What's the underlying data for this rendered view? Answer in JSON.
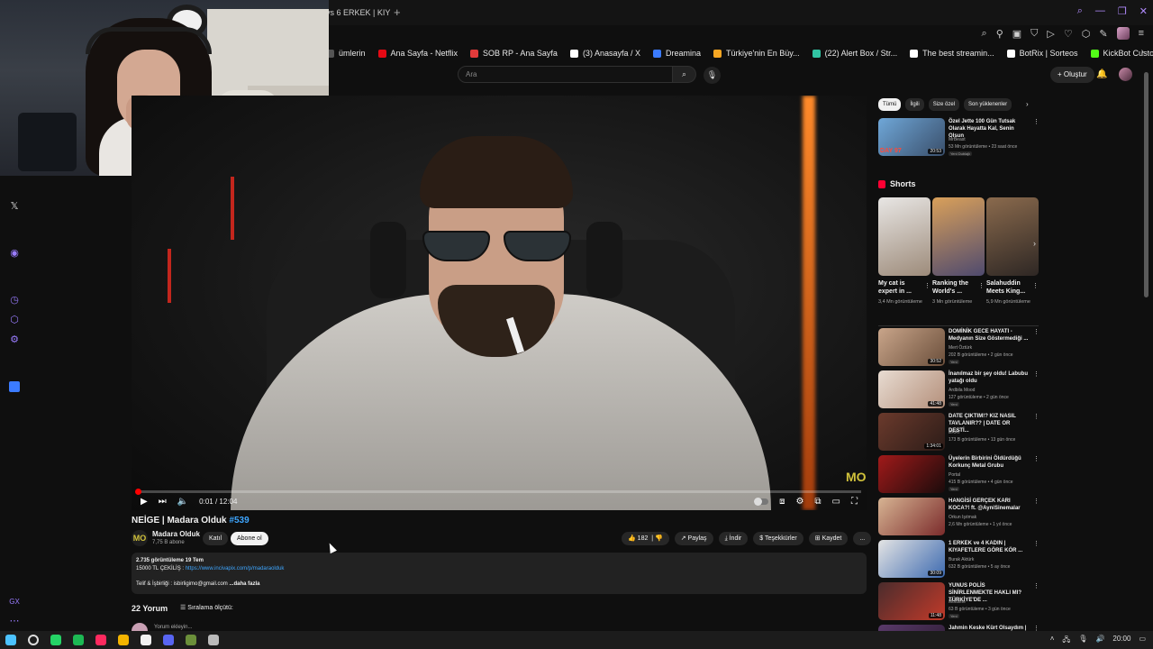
{
  "browser": {
    "tab_title": "ys 6 ERKEK | KIY",
    "tab_new": "+",
    "window_controls": [
      "search-icon",
      "minimize-icon",
      "restore-icon",
      "close-icon"
    ],
    "bookmarks": [
      {
        "label": "ümlerin",
        "color": "#555555"
      },
      {
        "label": "Ana Sayfa - Netflix",
        "color": "#e50914"
      },
      {
        "label": "SOB RP - Ana Sayfa",
        "color": "#e23b3b"
      },
      {
        "label": "(3) Anasayfa / X",
        "color": "#ffffff"
      },
      {
        "label": "Dreamina",
        "color": "#3b7bff"
      },
      {
        "label": "Türkiye'nin En Büy...",
        "color": "#f5a623"
      },
      {
        "label": "(22) Alert Box / Str...",
        "color": "#31c4a3"
      },
      {
        "label": "The best streamin...",
        "color": "#ffffff"
      },
      {
        "label": "BotRix | Sorteos",
        "color": "#ffffff"
      },
      {
        "label": "KickBot Custom C...",
        "color": "#53fc18"
      }
    ]
  },
  "youtube": {
    "search_placeholder": "Ara",
    "create_label": "+ Oluştur",
    "video": {
      "title": "NEİGE | Madara Olduk",
      "hashtag": "#539",
      "time": "0:01 / 12:04",
      "progress": 0.002,
      "watermark": "MO"
    },
    "channel": {
      "name": "Madara Olduk",
      "subs": "7,75 B abone",
      "avatar_text": "MO",
      "join_label": "Katıl",
      "subscribe_label": "Abone ol"
    },
    "actions": {
      "likes": "182",
      "share": "Paylaş",
      "download": "İndir",
      "thanks": "Teşekkürler",
      "save": "Kaydet",
      "more": "..."
    },
    "description": {
      "stats": "2.735 görüntüleme 19 Tem",
      "giveaway_label": "15000 TL ÇEKİLİŞ :",
      "giveaway_link": "https://www.incivapix.com/p/madaraolduk",
      "contact": "Telif & İşbirliği : isbirligimo@gmail.com",
      "more": "...daha fazla"
    },
    "comments": {
      "count": "22 Yorum",
      "sort_label": "Sıralama ölçütü:",
      "placeholder": "Yorum ekleyin..."
    },
    "chips": [
      {
        "label": "Tümü",
        "active": true
      },
      {
        "label": "İlgili",
        "active": false
      },
      {
        "label": "Size özel",
        "active": false
      },
      {
        "label": "Son yüklenenler",
        "active": false
      }
    ],
    "first_rec": {
      "title": "Özel Jette 100 Gün Tutsak Olarak Hayatta Kal, Senin Olsun",
      "channel": "MrBeast",
      "meta": "53 Mn görüntüleme • 23 saat önce",
      "badges": "Yeni   Dublajlı",
      "duration": "20:53",
      "thumb_text": "DAY 97"
    },
    "shorts_heading": "Shorts",
    "shorts": [
      {
        "title": "My cat is expert in ...",
        "views": "3,4 Mn görüntüleme",
        "color_a": "#e8e6e4",
        "color_b": "#9d8b7a"
      },
      {
        "title": "Ranking the World's ...",
        "views": "3 Mn görüntüleme",
        "color_a": "#d9a05a",
        "color_b": "#4f4a6e"
      },
      {
        "title": "Salahuddin Meets King...",
        "views": "5,9 Mn görüntüleme",
        "color_a": "#8a6a4d",
        "color_b": "#2e2724"
      }
    ],
    "recommendations": [
      {
        "title": "DOMİNİK GECE HAYATI - Medyanın Size Göstermediği ...",
        "channel": "Mert Öztürk",
        "meta": "202 B görüntüleme • 2 gün önce",
        "badge": "Yeni",
        "duration": "30:52",
        "color_a": "#c9a58a",
        "color_b": "#6b4f3b"
      },
      {
        "title": "İnanılmaz bir şey oldu! Labubu yatağı oldu",
        "channel": "Ardbila Mood",
        "meta": "127 görüntüleme • 2 gün önce",
        "badge": "Yeni",
        "duration": "41:48",
        "color_a": "#e8dcd2",
        "color_b": "#b48f7a"
      },
      {
        "title": "DATE ÇIKTIM!? KIZ NASIL TAVLANIR?? | DATE OR DESTİ...",
        "channel": "ERAY",
        "meta": "173 B görüntüleme • 13 gün önce",
        "badge": "",
        "duration": "1:34:01",
        "color_a": "#6b3a2c",
        "color_b": "#2c1c18"
      },
      {
        "title": "Üyelerin Birbirini Öldürdüğü Korkunç Metal Grubu",
        "channel": "Portal",
        "meta": "415 B görüntüleme • 4 gün önce",
        "badge": "Yeni",
        "duration": "",
        "color_a": "#a11a1a",
        "color_b": "#1a0b0b"
      },
      {
        "title": "HANGİSİ GERÇEK KARI KOCA?! ft. @AyniSinemalar",
        "channel": "Orkun Işıtmak",
        "meta": "2,6 Mn görüntüleme • 1 yıl önce",
        "badge": "",
        "duration": "",
        "color_a": "#d7b493",
        "color_b": "#7b2b2b"
      },
      {
        "title": "1 ERKEK ve 4 KADIN | KIYAFETLERE GÖRE KÖR ...",
        "channel": "Burak Aktürk",
        "meta": "632 B görüntüleme • 5 ay önce",
        "badge": "",
        "duration": "30:09",
        "color_a": "#e4e4e4",
        "color_b": "#3d6ab0"
      },
      {
        "title": "YUNUS POLİS SİNİRLENMEKTE HAKLI MI? TÜRKİYE'DE ...",
        "channel": "Motoline",
        "meta": "63 B görüntüleme • 3 gün önce",
        "badge": "Yeni",
        "duration": "11:48",
        "color_a": "#4a2c2c",
        "color_b": "#c23a2a"
      },
      {
        "title": "Jahmin Keske Kürt Olsaydım | ...",
        "channel": "",
        "meta": "",
        "badge": "",
        "duration": "",
        "color_a": "#5a3a6a",
        "color_b": "#2a1a30"
      }
    ]
  },
  "taskbar": {
    "time": "20:00",
    "icons": [
      {
        "name": "windows-start-icon",
        "color": "#4cc2ff"
      },
      {
        "name": "search-icon",
        "color": "#dddddd"
      },
      {
        "name": "whatsapp-icon",
        "color": "#25d366"
      },
      {
        "name": "spotify-icon",
        "color": "#1db954"
      },
      {
        "name": "opera-gx-icon",
        "color": "#ff2a5f"
      },
      {
        "name": "chrome-icon",
        "color": "#f4b400"
      },
      {
        "name": "capcut-icon",
        "color": "#f1f1f1"
      },
      {
        "name": "discord-icon",
        "color": "#5865f2"
      },
      {
        "name": "app-icon",
        "color": "#6b8f3a"
      },
      {
        "name": "obs-icon",
        "color": "#bbbbbb"
      }
    ]
  }
}
